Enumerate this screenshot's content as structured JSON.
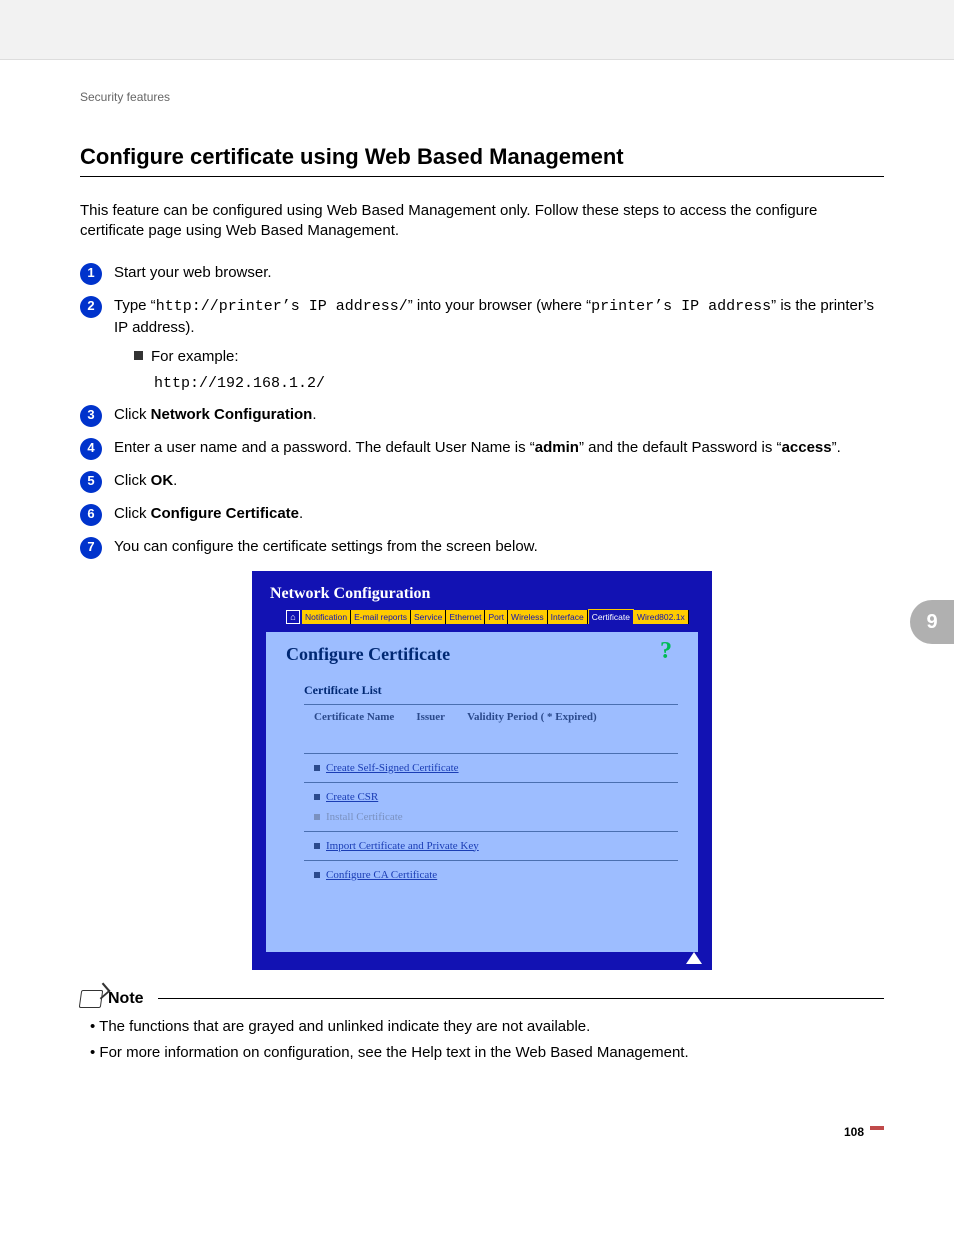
{
  "breadcrumb": "Security features",
  "heading": "Configure certificate using Web Based Management",
  "intro": "This feature can be configured using Web Based Management only. Follow these steps to access the configure certificate page using Web Based Management.",
  "chapter": "9",
  "page_number": "108",
  "steps": {
    "s1": "Start your web browser.",
    "s2_a": "Type “",
    "s2_code1": "http://printer’s IP address/",
    "s2_b": "” into your browser (where “",
    "s2_code2": "printer’s IP address",
    "s2_c": "” is the printer’s IP address).",
    "s2_sub_label": "For example:",
    "s2_sub_code": "http://192.168.1.2/",
    "s3_a": "Click ",
    "s3_b": "Network Configuration",
    "s3_c": ".",
    "s4_a": "Enter a user name and a password. The default User Name is “",
    "s4_b": "admin",
    "s4_c": "” and the default Password is “",
    "s4_d": "access",
    "s4_e": "”.",
    "s5_a": "Click ",
    "s5_b": "OK",
    "s5_c": ".",
    "s6_a": "Click ",
    "s6_b": "Configure Certificate",
    "s6_c": ".",
    "s7": "You can configure the certificate settings from the screen below."
  },
  "screenshot": {
    "title": "Network Configuration",
    "tabs": {
      "t1": "Notification",
      "t2": "E-mail reports",
      "t3": "Service",
      "t4": "Ethernet",
      "t5": "Port",
      "t6": "Wireless",
      "t7": "Interface",
      "t8": "Certificate",
      "t9": "Wired802.1x"
    },
    "panel_title": "Configure Certificate",
    "cert_list_hdr": "Certificate List",
    "col1": "Certificate Name",
    "col2": "Issuer",
    "col3": "Validity Period ( * Expired)",
    "links": {
      "l1": "Create Self-Signed Certificate",
      "l2": "Create CSR",
      "l3": "Install Certificate",
      "l4": "Import Certificate and Private Key",
      "l5": "Configure CA Certificate"
    }
  },
  "note": {
    "label": "Note",
    "n1": "The functions that are grayed and unlinked indicate they are not available.",
    "n2": "For more information on configuration, see the Help text in the Web Based Management."
  }
}
